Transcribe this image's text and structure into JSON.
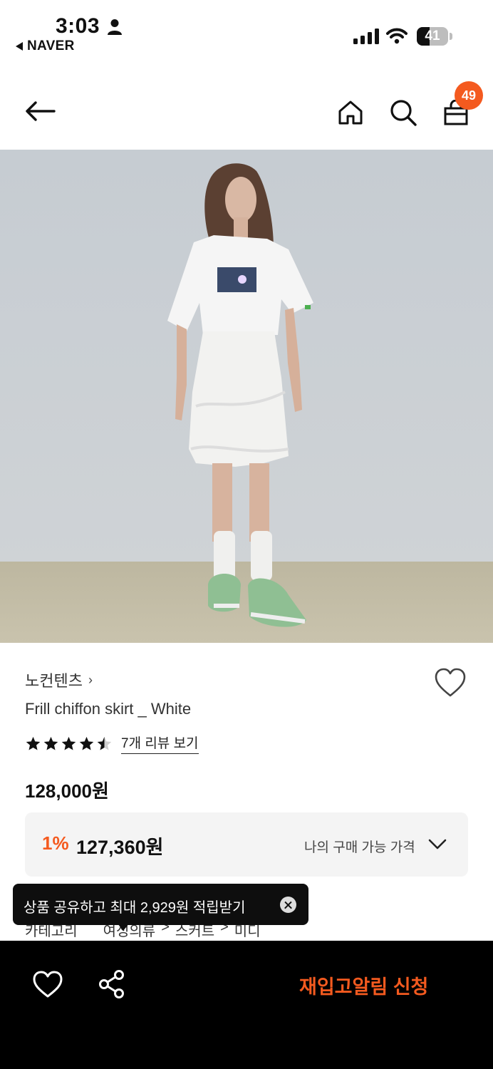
{
  "status_bar": {
    "time": "3:03",
    "back_app": "NAVER",
    "battery": "41",
    "battery_level": 0.41
  },
  "header": {
    "cart_count": "49"
  },
  "product": {
    "brand": "노컨텐츠",
    "name": "Frill chiffon skirt _ White",
    "rating": 4.5,
    "review_link": "7개 리뷰 보기",
    "price": "128,000원"
  },
  "my_price": {
    "discount": "1%",
    "amount": "127,360원",
    "label": "나의 구매 가능 가격"
  },
  "category": {
    "label": "카테고리",
    "path": [
      "여성의류",
      ">",
      "스커트",
      ">",
      "미디"
    ]
  },
  "tooltip": {
    "text": "상품 공유하고 최대 2,929원 적립받기"
  },
  "bottom_bar": {
    "restock_label": "재입고알림 신청"
  },
  "colors": {
    "accent": "#f45a1f",
    "dark": "#000000"
  },
  "icons": [
    "arrow-left-icon",
    "home-icon",
    "search-icon",
    "shopping-bag-icon",
    "heart-icon",
    "share-icon",
    "chevron-down-icon",
    "close-icon",
    "star-icon"
  ]
}
